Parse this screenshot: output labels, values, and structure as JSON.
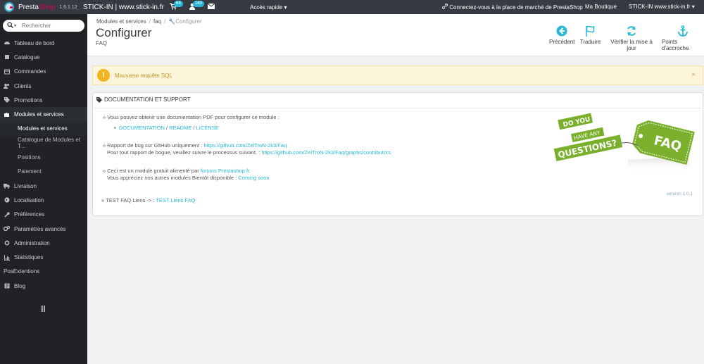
{
  "topbar": {
    "brand_a": "Presta",
    "brand_b": "Shop",
    "version": "1.6.1.12",
    "shop": "STICK-IN | www.stick-in.fr",
    "cart_count": "68",
    "customers_count": "183",
    "quick_access": "Accès rapide ▾",
    "connect": "Connectez-vous à la place de marché de PrestaShop",
    "my_shop": "Ma Boutique",
    "user_shop": "STICK-IN www.stick-in.fr ▾"
  },
  "search": {
    "placeholder": "Rechercher"
  },
  "sidebar": {
    "items": [
      {
        "label": "Tableau de bord",
        "icon": "dashboard-icon"
      },
      {
        "label": "Catalogue",
        "icon": "catalog-icon"
      },
      {
        "label": "Commandes",
        "icon": "orders-icon"
      },
      {
        "label": "Clients",
        "icon": "customers-icon"
      },
      {
        "label": "Promotions",
        "icon": "promotions-icon"
      },
      {
        "label": "Modules et services",
        "icon": "puzzle-icon"
      },
      {
        "label": "Modules et services"
      },
      {
        "label": "Catalogue de Modules et T..."
      },
      {
        "label": "Positions"
      },
      {
        "label": "Paiement"
      },
      {
        "label": "Livraison",
        "icon": "truck-icon"
      },
      {
        "label": "Localisation",
        "icon": "globe-icon"
      },
      {
        "label": "Préférences",
        "icon": "wrench-icon"
      },
      {
        "label": "Paramètres avancés",
        "icon": "cogs-icon"
      },
      {
        "label": "Administration",
        "icon": "cog-icon"
      },
      {
        "label": "Statistiques",
        "icon": "chart-icon"
      },
      {
        "label": "PosExtentions"
      },
      {
        "label": "Blog",
        "icon": "blog-icon"
      }
    ]
  },
  "breadcrumb": {
    "a": "Modules et services",
    "b": "faq",
    "c": "Configurer"
  },
  "page": {
    "title": "Configurer",
    "subtitle": "FAQ"
  },
  "toolbar": {
    "back": "Précédent",
    "translate": "Traduire",
    "check_update": "Vérifier la mise à jour",
    "hooks": "Points d'accroche"
  },
  "alert": {
    "message": "Mauvaise requête SQL",
    "close": "×"
  },
  "panel": {
    "title": "DOCUMENTATION ET SUPPORT",
    "l1": "» Vous pouvez obtenir une documentation PDF pour configurer ce module :",
    "doc": "DOCUMENTATION",
    "readme": "README",
    "license": "LICENSE",
    "slash": "/",
    "bullet": "•",
    "l2_prefix": "» Rapport de bug sur GitHub uniquement :",
    "l2_link": "https://github.com/ZelTroN-2k3/Faq",
    "l3_prefix": "Pour tout rapport de bogue, veuillez suivre le processus suivant. :",
    "l3_link": "https://github.com/ZelTroN-2k3/Faq/graphs/contributors",
    "l4_prefix": "» Ceci est un module gratuit alimenté par",
    "l4_link": "forums Prestashop fr",
    "l4_suffix": ".",
    "l5_prefix": "Vous appréciez nos autres modules Bientôt disponible :",
    "l5_link": "Coming soon",
    "version": "version 1.0.1",
    "l6_prefix": "» TEST FAQ Liens -> :",
    "l6_link": "TEST Liens FAQ"
  },
  "faq_image": {
    "do": "DO",
    "you": "YOU",
    "have_any": "HAVE ANY",
    "questions": "QUESTIONS?",
    "faq": "FAQ"
  },
  "colors": {
    "accent": "#25b9d7",
    "topbar": "#363a41",
    "sidebar": "#202226",
    "warning": "#f2b51f",
    "faq_green": "#7ab02c"
  }
}
